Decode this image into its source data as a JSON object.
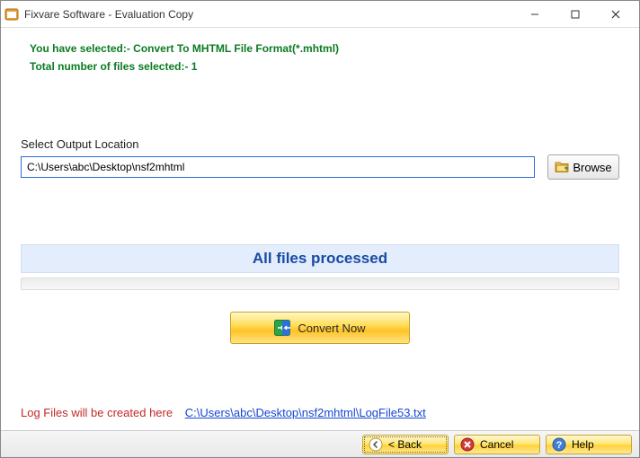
{
  "window": {
    "title": "Fixvare Software - Evaluation Copy"
  },
  "info": {
    "line1": "You have selected:- Convert To MHTML File Format(*.mhtml)",
    "line2": "Total number of files selected:- 1"
  },
  "output": {
    "label": "Select Output Location",
    "path": "C:\\Users\\abc\\Desktop\\nsf2mhtml",
    "browse_label": "Browse"
  },
  "status": {
    "text": "All files processed"
  },
  "convert": {
    "label": "Convert Now"
  },
  "log": {
    "label": "Log Files will be created here",
    "link": "C:\\Users\\abc\\Desktop\\nsf2mhtml\\LogFile53.txt"
  },
  "footer": {
    "back": "< Back",
    "cancel": "Cancel",
    "help": "Help"
  }
}
